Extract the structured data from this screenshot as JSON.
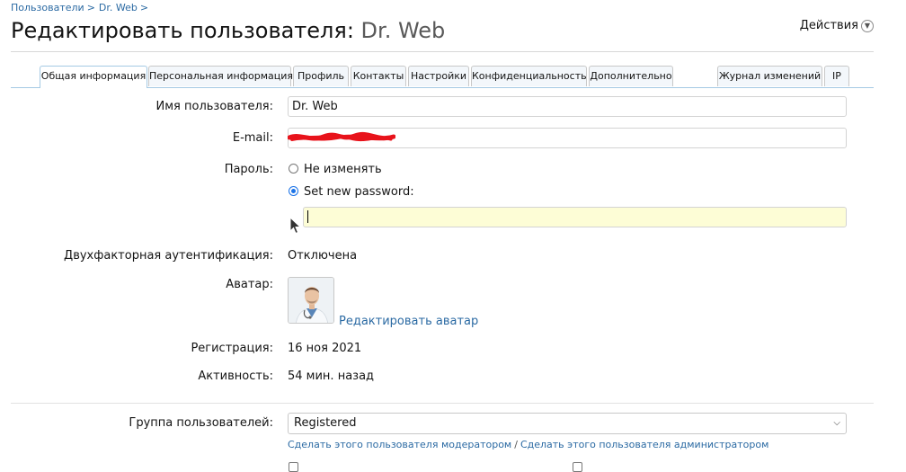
{
  "breadcrumb": {
    "items": [
      "Пользователи",
      "Dr. Web"
    ],
    "sep": ">"
  },
  "title": {
    "prefix": "Редактировать пользователя:",
    "username": "Dr. Web"
  },
  "actions_label": "Действия",
  "tabs": [
    "Общая информация",
    "Персональная информация",
    "Профиль",
    "Контакты",
    "Настройки",
    "Конфиденциальность",
    "Дополнительно",
    "Журнал изменений",
    "IP"
  ],
  "form": {
    "username_label": "Имя пользователя:",
    "username_value": "Dr. Web",
    "email_label": "E-mail:",
    "email_value": "",
    "password_label": "Пароль:",
    "password_option_keep": "Не изменять",
    "password_option_new": "Set new password:",
    "password_value": "",
    "twofa_label": "Двухфакторная аутентификация:",
    "twofa_value": "Отключена",
    "avatar_label": "Аватар:",
    "avatar_edit_link": "Редактировать аватар",
    "registration_label": "Регистрация:",
    "registration_value": "16 ноя 2021",
    "activity_label": "Активность:",
    "activity_value": "54 мин. назад",
    "group_label": "Группа пользователей:",
    "group_value": "Registered",
    "make_moderator_link": "Сделать этого пользователя модератором",
    "make_admin_link": "Сделать этого пользователя администратором",
    "links_separator": "/"
  },
  "colors": {
    "link": "#2b6aa3",
    "tab_border": "#a5cae4",
    "focus_input_bg": "#fdfdd6",
    "redaction": "#e8131b"
  }
}
